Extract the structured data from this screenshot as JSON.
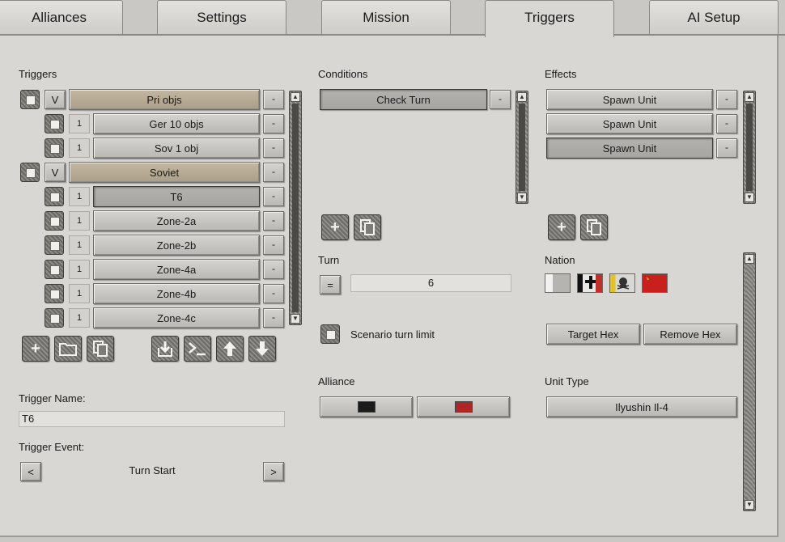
{
  "tabs": [
    "Alliances",
    "Settings",
    "Mission",
    "Triggers",
    "AI Setup"
  ],
  "triggers": {
    "label": "Triggers",
    "rows": [
      {
        "type": "group",
        "toggle": "V",
        "name": "Pri objs"
      },
      {
        "type": "item",
        "count": "1",
        "name": "Ger 10 objs"
      },
      {
        "type": "item",
        "count": "1",
        "name": "Sov 1 obj"
      },
      {
        "type": "group",
        "toggle": "V",
        "name": "Soviet"
      },
      {
        "type": "item",
        "count": "1",
        "name": "T6",
        "selected": true
      },
      {
        "type": "item",
        "count": "1",
        "name": "Zone-2a"
      },
      {
        "type": "item",
        "count": "1",
        "name": "Zone-2b"
      },
      {
        "type": "item",
        "count": "1",
        "name": "Zone-4a"
      },
      {
        "type": "item",
        "count": "1",
        "name": "Zone-4b"
      },
      {
        "type": "item",
        "count": "1",
        "name": "Zone-4c"
      }
    ],
    "remove_label": "-",
    "toolbar_icons": [
      "add-icon",
      "folder-icon",
      "copy-icon",
      "import-icon",
      "console-icon",
      "move-up-icon",
      "move-down-icon"
    ]
  },
  "trigger_name": {
    "label": "Trigger Name:",
    "value": "T6"
  },
  "trigger_event": {
    "label": "Trigger Event:",
    "value": "Turn Start",
    "prev": "<",
    "next": ">"
  },
  "conditions": {
    "label": "Conditions",
    "items": [
      {
        "name": "Check Turn"
      }
    ],
    "remove_label": "-"
  },
  "turn": {
    "label": "Turn",
    "operator": "=",
    "value": "6"
  },
  "scenario_turn_limit": {
    "label": "Scenario turn limit"
  },
  "alliance": {
    "label": "Alliance",
    "colors": [
      "#1b1b1b",
      "#b02624"
    ]
  },
  "effects": {
    "label": "Effects",
    "items": [
      {
        "name": "Spawn Unit"
      },
      {
        "name": "Spawn Unit"
      },
      {
        "name": "Spawn Unit",
        "selected": true
      }
    ],
    "remove_label": "-"
  },
  "nation": {
    "label": "Nation",
    "flags": [
      "white-gray-flag",
      "german-cross-flag",
      "skull-flag",
      "soviet-red-flag"
    ]
  },
  "hex": {
    "target": "Target Hex",
    "remove": "Remove Hex"
  },
  "unit_type": {
    "label": "Unit Type",
    "value": "Ilyushin Il-4"
  }
}
